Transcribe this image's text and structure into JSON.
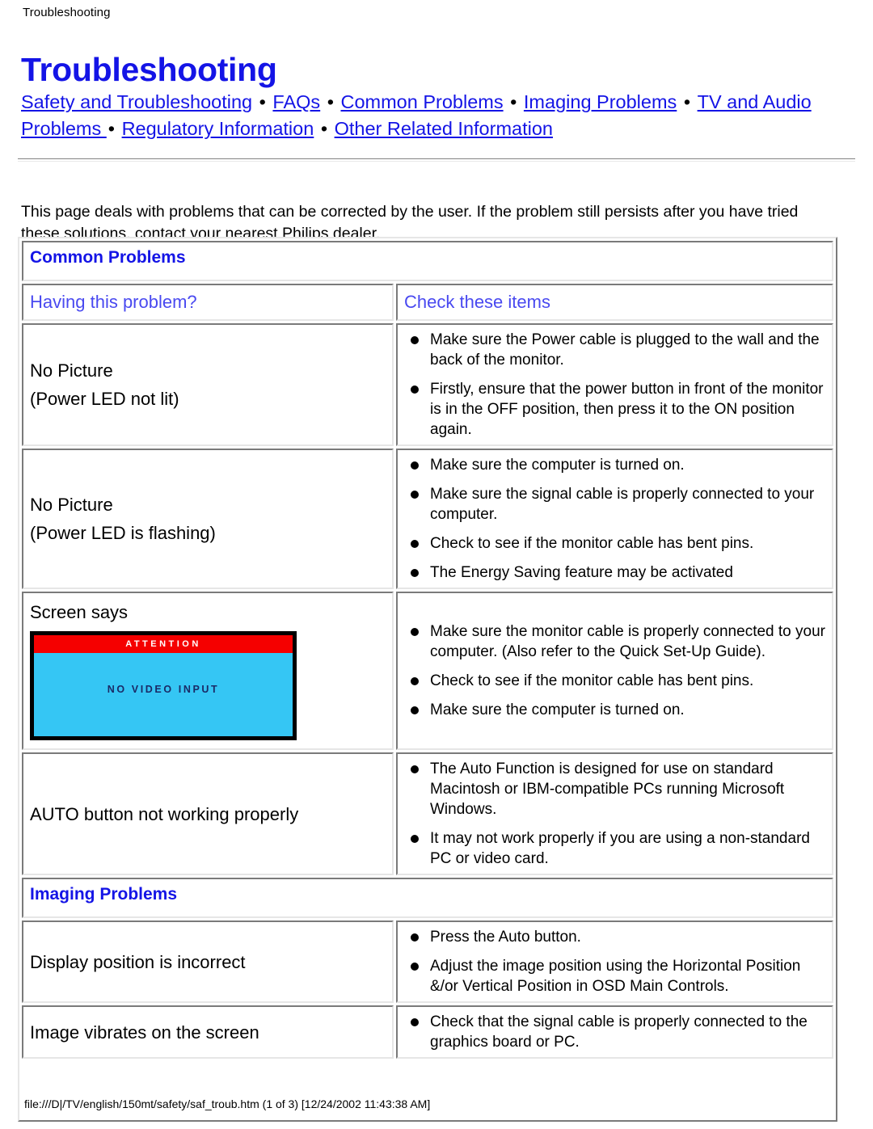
{
  "breadcrumb": "Troubleshooting",
  "page_title": "Troubleshooting",
  "colors": {
    "link": "#1414e6",
    "heading_blue": "#1414e6",
    "table_header_blue": "#4949f0",
    "monitor_attention_bar": "#f50000",
    "monitor_screen": "#35c6f4",
    "monitor_text": "#1a2a66"
  },
  "nav": {
    "separator": "•",
    "links": [
      "Safety and Troubleshooting",
      "FAQs",
      "Common Problems",
      "Imaging Problems",
      "TV and Audio Problems ",
      "Regulatory Information",
      "Other Related Information"
    ]
  },
  "intro": "This page deals with problems that can be corrected by the user. If the problem still persists after you have tried these solutions, contact your nearest Philips dealer.",
  "table": {
    "sections": [
      {
        "title": "Common Problems",
        "columns": {
          "left": "Having this problem?",
          "right": "Check these items"
        },
        "has_column_header": true,
        "rows": [
          {
            "problem_lines": [
              "No Picture",
              "(Power LED not lit)"
            ],
            "checks": [
              "Make sure the Power cable is plugged to the wall and the back of the monitor.",
              "Firstly, ensure that the power button in front of the monitor is in the OFF position, then press it to the ON position again."
            ]
          },
          {
            "problem_lines": [
              "No Picture",
              "(Power LED is flashing)"
            ],
            "checks": [
              "Make sure the computer is turned on.",
              "Make sure the signal cable is properly connected to your computer.",
              "Check to see if the monitor cable has bent pins.",
              "The Energy Saving feature may be activated"
            ]
          },
          {
            "problem_lines": [
              "Screen says"
            ],
            "image": {
              "name": "monitor-no-video-input",
              "attention_label": "ATTENTION",
              "message": "NO VIDEO INPUT"
            },
            "checks": [
              "Make sure the monitor cable is properly connected to your computer. (Also refer to the Quick Set-Up Guide).",
              "Check to see if the monitor cable has bent pins.",
              "Make sure the computer is turned on."
            ]
          },
          {
            "problem_lines": [
              "AUTO button not working properly"
            ],
            "checks": [
              "The Auto Function is designed for use on standard Macintosh or IBM-compatible PCs running Microsoft Windows.",
              "It may not work properly if you are using a non-standard PC or video card."
            ]
          }
        ]
      },
      {
        "title": "Imaging Problems",
        "has_column_header": false,
        "rows": [
          {
            "problem_lines": [
              "Display position is incorrect"
            ],
            "checks": [
              "Press the Auto button.",
              "Adjust the image position using the Horizontal Position &/or Vertical Position in OSD Main Controls."
            ]
          },
          {
            "problem_lines": [
              "Image vibrates on the screen"
            ],
            "checks": [
              "Check that the signal cable is properly connected to the graphics board or PC."
            ]
          }
        ]
      }
    ]
  },
  "footer": "file:///D|/TV/english/150mt/safety/saf_troub.htm (1 of 3) [12/24/2002 11:43:38 AM]"
}
